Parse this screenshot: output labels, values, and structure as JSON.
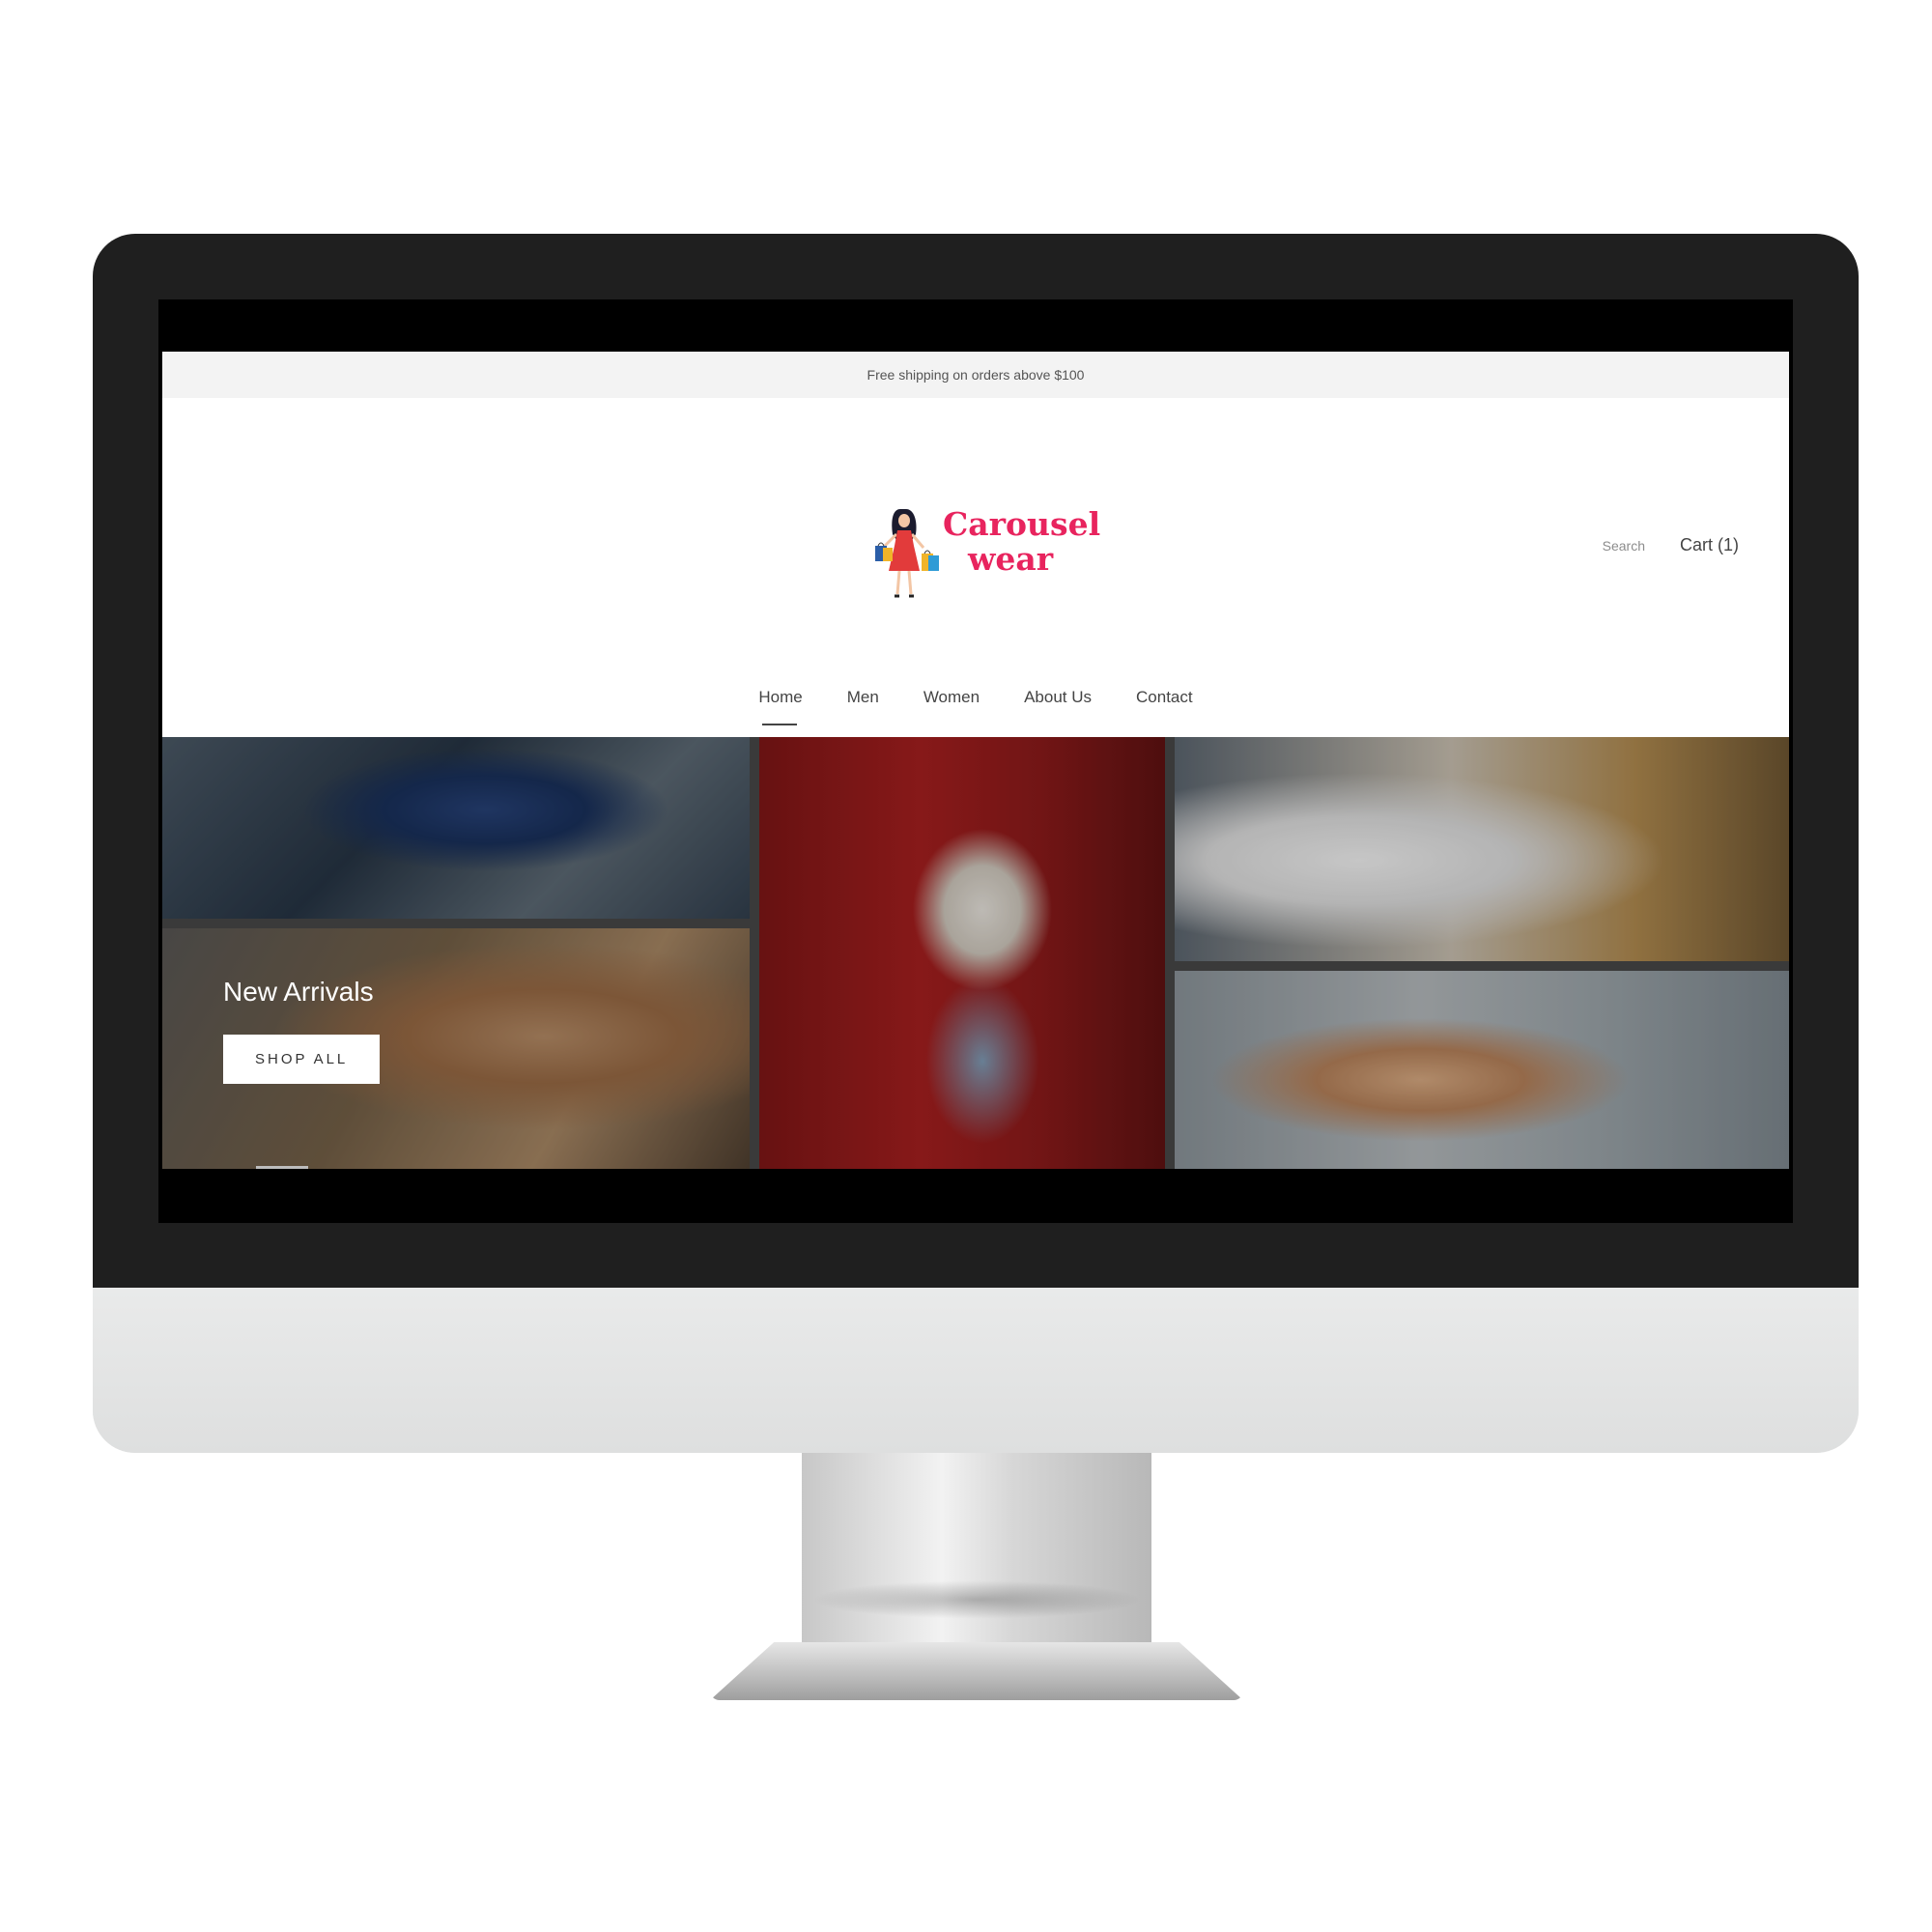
{
  "site": {
    "announcement": "Free shipping on orders above $100",
    "logo": {
      "line1": "Carousel",
      "line2": "wear",
      "brand_color": "#e8245e"
    },
    "header": {
      "search_label": "Search",
      "cart_label": "Cart (1)"
    },
    "nav": [
      {
        "label": "Home",
        "active": true
      },
      {
        "label": "Men"
      },
      {
        "label": "Women"
      },
      {
        "label": "About Us"
      },
      {
        "label": "Contact"
      }
    ],
    "hero": {
      "title": "New Arrivals",
      "button_label": "SHOP ALL"
    }
  }
}
